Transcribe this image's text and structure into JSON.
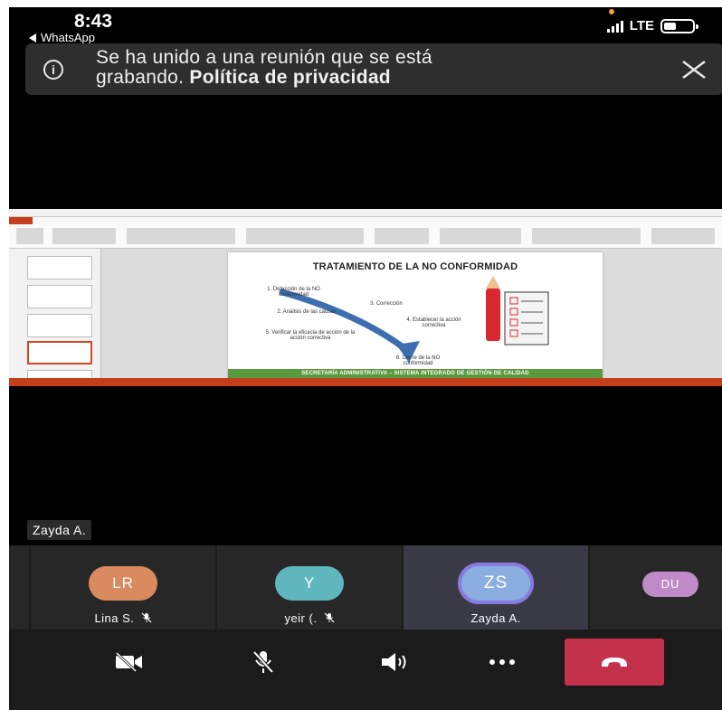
{
  "status_bar": {
    "time": "8:43",
    "back_app": "WhatsApp",
    "network": "LTE",
    "icons": [
      "signal-icon",
      "battery-icon"
    ]
  },
  "banner": {
    "text_line1": "Se ha unido a una reunión que se está",
    "text_line2_prefix": "grabando. ",
    "text_line2_link": "Política de privacidad",
    "icons": [
      "info-icon",
      "close-icon"
    ]
  },
  "shared_slide": {
    "title": "TRATAMIENTO DE LA NO CONFORMIDAD",
    "steps": [
      "1. Detección de la NO conformidad",
      "2. Análisis de las causas",
      "3. Corrección",
      "4. Establecer la acción correctiva",
      "5. Verificar la eficacia de acción de la acción correctiva",
      "6. Cierre de la NO conformidad"
    ],
    "footer": "SECRETARÍA ADMINISTRATIVA – SISTEMA INTEGRADO DE GESTIÓN DE CALIDAD"
  },
  "speaker_label": "Zayda A.",
  "participants": [
    {
      "initials": "",
      "name": "",
      "color": "#555555"
    },
    {
      "initials": "LR",
      "name": "Lina S.",
      "color": "#d98a5f",
      "muted": true
    },
    {
      "initials": "Y",
      "name": "yeir (.",
      "color": "#5fb6bd",
      "muted": true
    },
    {
      "initials": "ZS",
      "name": "Zayda A.",
      "color": "#8aaee0",
      "active": true
    },
    {
      "initials": "DU",
      "name": "",
      "color": "#c08ac8"
    }
  ],
  "controls": [
    {
      "name": "camera-off-button",
      "icon": "video-off-icon"
    },
    {
      "name": "mic-off-button",
      "icon": "mic-off-icon"
    },
    {
      "name": "speaker-button",
      "icon": "speaker-icon"
    },
    {
      "name": "more-button",
      "icon": "more-icon"
    },
    {
      "name": "hangup-button",
      "icon": "phone-hangup-icon",
      "color": "#c4314b"
    }
  ],
  "colors": {
    "background": "#000000",
    "panel": "#1b1b1b",
    "tile": "#272727",
    "active_tile": "#3a3a46",
    "active_ring": "#8a7ae0",
    "hangup": "#c4314b",
    "ppt_accent": "#c43e1c",
    "slide_footer": "#5a9a3c"
  }
}
